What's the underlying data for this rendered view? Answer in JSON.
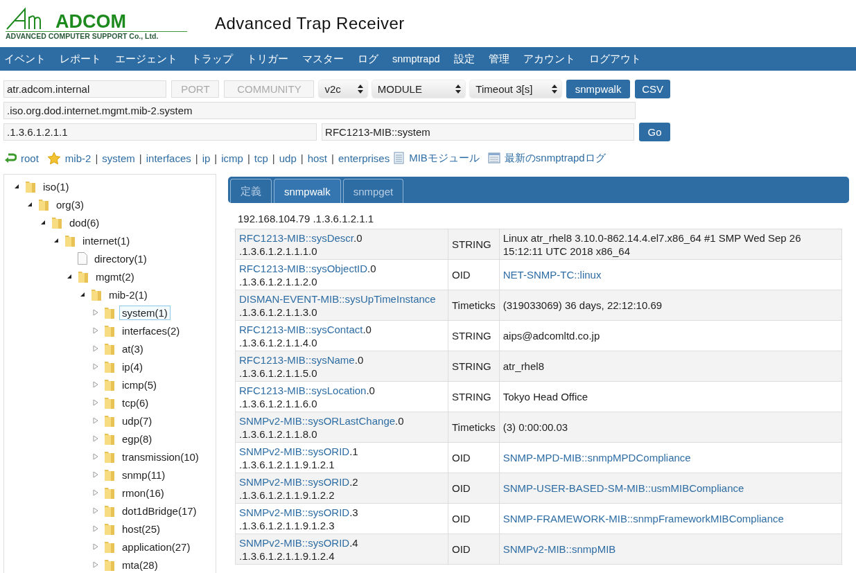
{
  "brand": {
    "name": "ADCOM",
    "subtitle": "ADVANCED COMPUTER SUPPORT Co., Ltd."
  },
  "app_title": "Advanced Trap Receiver",
  "nav": [
    "イベント",
    "レポート",
    "エージェント",
    "トラップ",
    "トリガー",
    "マスター",
    "ログ",
    "snmptrapd",
    "設定",
    "管理",
    "アカウント",
    "ログアウト"
  ],
  "form": {
    "host": {
      "value": "atr.adcom.internal"
    },
    "port": {
      "placeholder": "PORT"
    },
    "community": {
      "placeholder": "COMMUNITY"
    },
    "version": {
      "value": "v2c"
    },
    "module": {
      "value": "MODULE"
    },
    "timeout": {
      "value": "Timeout 3[s]"
    },
    "walk_button": "snmpwalk",
    "csv_button": "CSV",
    "oid_path": {
      "value": ".iso.org.dod.internet.mgmt.mib-2.system"
    },
    "oid": {
      "value": ".1.3.6.1.2.1.1"
    },
    "oid_name": {
      "value": "RFC1213-MIB::system"
    },
    "go_button": "Go"
  },
  "quick_links": [
    {
      "kind": "back-link",
      "label": "root"
    },
    {
      "kind": "star-link",
      "label": "mib-2"
    },
    {
      "kind": "sep",
      "label": "|"
    },
    {
      "kind": "link",
      "label": "system"
    },
    {
      "kind": "sep",
      "label": "|"
    },
    {
      "kind": "link",
      "label": "interfaces"
    },
    {
      "kind": "sep",
      "label": "|"
    },
    {
      "kind": "link",
      "label": "ip"
    },
    {
      "kind": "sep",
      "label": "|"
    },
    {
      "kind": "link",
      "label": "icmp"
    },
    {
      "kind": "sep",
      "label": "|"
    },
    {
      "kind": "link",
      "label": "tcp"
    },
    {
      "kind": "sep",
      "label": "|"
    },
    {
      "kind": "link",
      "label": "udp"
    },
    {
      "kind": "sep",
      "label": "|"
    },
    {
      "kind": "link",
      "label": "host"
    },
    {
      "kind": "sep",
      "label": "|"
    },
    {
      "kind": "link",
      "label": "enterprises"
    },
    {
      "kind": "module-link",
      "label": "MIBモジュール"
    },
    {
      "kind": "log-link",
      "label": "最新のsnmptrapdログ"
    }
  ],
  "tree": [
    {
      "label": "iso(1)",
      "kind": "folder",
      "expanded": true,
      "selected": false,
      "children": [
        {
          "label": "org(3)",
          "kind": "folder",
          "expanded": true,
          "selected": false,
          "children": [
            {
              "label": "dod(6)",
              "kind": "folder",
              "expanded": true,
              "selected": false,
              "children": [
                {
                  "label": "internet(1)",
                  "kind": "folder",
                  "expanded": true,
                  "selected": false,
                  "children": [
                    {
                      "label": "directory(1)",
                      "kind": "file",
                      "selected": false
                    },
                    {
                      "label": "mgmt(2)",
                      "kind": "folder",
                      "expanded": true,
                      "selected": false,
                      "children": [
                        {
                          "label": "mib-2(1)",
                          "kind": "folder",
                          "expanded": true,
                          "selected": false,
                          "children": [
                            {
                              "label": "system(1)",
                              "kind": "folder",
                              "expanded": false,
                              "selected": true
                            },
                            {
                              "label": "interfaces(2)",
                              "kind": "folder",
                              "expanded": false,
                              "selected": false
                            },
                            {
                              "label": "at(3)",
                              "kind": "folder",
                              "expanded": false,
                              "selected": false
                            },
                            {
                              "label": "ip(4)",
                              "kind": "folder",
                              "expanded": false,
                              "selected": false
                            },
                            {
                              "label": "icmp(5)",
                              "kind": "folder",
                              "expanded": false,
                              "selected": false
                            },
                            {
                              "label": "tcp(6)",
                              "kind": "folder",
                              "expanded": false,
                              "selected": false
                            },
                            {
                              "label": "udp(7)",
                              "kind": "folder",
                              "expanded": false,
                              "selected": false
                            },
                            {
                              "label": "egp(8)",
                              "kind": "folder",
                              "expanded": false,
                              "selected": false
                            },
                            {
                              "label": "transmission(10)",
                              "kind": "folder",
                              "expanded": false,
                              "selected": false
                            },
                            {
                              "label": "snmp(11)",
                              "kind": "folder",
                              "expanded": false,
                              "selected": false
                            },
                            {
                              "label": "rmon(16)",
                              "kind": "folder",
                              "expanded": false,
                              "selected": false
                            },
                            {
                              "label": "dot1dBridge(17)",
                              "kind": "folder",
                              "expanded": false,
                              "selected": false
                            },
                            {
                              "label": "host(25)",
                              "kind": "folder",
                              "expanded": false,
                              "selected": false
                            },
                            {
                              "label": "application(27)",
                              "kind": "folder",
                              "expanded": false,
                              "selected": false
                            },
                            {
                              "label": "mta(28)",
                              "kind": "folder",
                              "expanded": false,
                              "selected": false
                            }
                          ]
                        }
                      ]
                    }
                  ]
                }
              ]
            }
          ]
        }
      ]
    }
  ],
  "tabs": [
    {
      "label": "定義",
      "selected": false
    },
    {
      "label": "snmpwalk",
      "selected": true
    },
    {
      "label": "snmpget",
      "selected": false
    }
  ],
  "result_header": "192.168.104.79 .1.3.6.1.2.1.1",
  "results": [
    {
      "name": "RFC1213-MIB::sysDescr",
      "suffix": ".0",
      "oid": ".1.3.6.1.2.1.1.1.0",
      "type": "STRING",
      "kind": "text",
      "value": "Linux atr_rhel8 3.10.0-862.14.4.el7.x86_64 #1 SMP Wed Sep 26 15:12:11 UTC 2018 x86_64"
    },
    {
      "name": "RFC1213-MIB::sysObjectID",
      "suffix": ".0",
      "oid": ".1.3.6.1.2.1.1.2.0",
      "type": "OID",
      "kind": "link",
      "value": "NET-SNMP-TC::linux"
    },
    {
      "name": "DISMAN-EVENT-MIB::sysUpTimeInstance",
      "oid": ".1.3.6.1.2.1.1.3.0",
      "type": "Timeticks",
      "kind": "text",
      "value": "(319033069) 36 days, 22:12:10.69"
    },
    {
      "name": "RFC1213-MIB::sysContact",
      "suffix": ".0",
      "oid": ".1.3.6.1.2.1.1.4.0",
      "type": "STRING",
      "kind": "text",
      "value": "aips@adcomltd.co.jp"
    },
    {
      "name": "RFC1213-MIB::sysName",
      "suffix": ".0",
      "oid": ".1.3.6.1.2.1.1.5.0",
      "type": "STRING",
      "kind": "text",
      "value": "atr_rhel8"
    },
    {
      "name": "RFC1213-MIB::sysLocation",
      "suffix": ".0",
      "oid": ".1.3.6.1.2.1.1.6.0",
      "type": "STRING",
      "kind": "text",
      "value": "Tokyo Head Office"
    },
    {
      "name": "SNMPv2-MIB::sysORLastChange",
      "suffix": ".0",
      "oid": ".1.3.6.1.2.1.1.8.0",
      "type": "Timeticks",
      "kind": "text",
      "value": "(3) 0:00:00.03"
    },
    {
      "name": "SNMPv2-MIB::sysORID",
      "suffix": ".1",
      "oid": ".1.3.6.1.2.1.1.9.1.2.1",
      "type": "OID",
      "kind": "link",
      "value": "SNMP-MPD-MIB::snmpMPDCompliance"
    },
    {
      "name": "SNMPv2-MIB::sysORID",
      "suffix": ".2",
      "oid": ".1.3.6.1.2.1.1.9.1.2.2",
      "type": "OID",
      "kind": "link",
      "value": "SNMP-USER-BASED-SM-MIB::usmMIBCompliance"
    },
    {
      "name": "SNMPv2-MIB::sysORID",
      "suffix": ".3",
      "oid": ".1.3.6.1.2.1.1.9.1.2.3",
      "type": "OID",
      "kind": "link",
      "value": "SNMP-FRAMEWORK-MIB::snmpFrameworkMIBCompliance"
    },
    {
      "name": "SNMPv2-MIB::sysORID",
      "suffix": ".4",
      "oid": ".1.3.6.1.2.1.1.9.1.2.4",
      "type": "OID",
      "kind": "link",
      "value": "SNMPv2-MIB::snmpMIB"
    }
  ]
}
